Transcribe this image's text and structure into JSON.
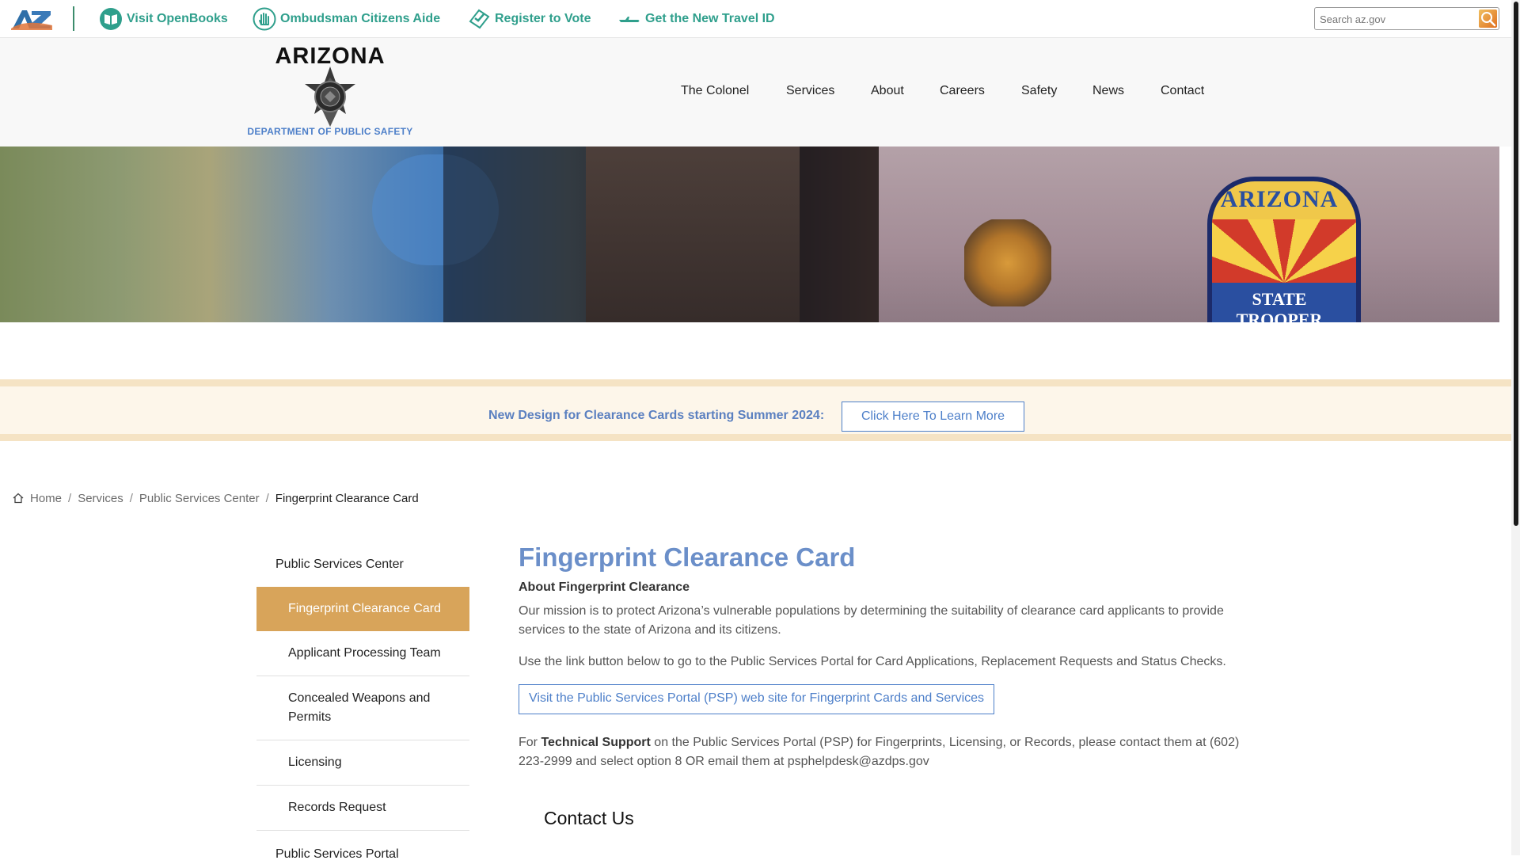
{
  "utility_bar": {
    "links": [
      {
        "label": "Visit OpenBooks",
        "icon": "book-icon"
      },
      {
        "label": "Ombudsman Citizens Aide",
        "icon": "hand-icon"
      },
      {
        "label": "Register to Vote",
        "icon": "ballot-icon"
      },
      {
        "label": "Get the New Travel ID",
        "icon": "plane-icon"
      }
    ],
    "search_placeholder": "Search az.gov"
  },
  "header": {
    "logo_wordmark": "ARIZONA",
    "agency_name": "DEPARTMENT OF PUBLIC SAFETY",
    "nav": [
      "The Colonel",
      "Services",
      "About",
      "Careers",
      "Safety",
      "News",
      "Contact"
    ]
  },
  "hero": {
    "patch_title": "ARIZONA",
    "patch_subtitle_1": "STATE",
    "patch_subtitle_2": "TROOPER"
  },
  "notice": {
    "text": "New Design for Clearance Cards starting Summer 2024:",
    "button": "Click Here To Learn More"
  },
  "breadcrumb": {
    "items": [
      "Home",
      "Services",
      "Public Services Center"
    ],
    "separator": "/",
    "current": "Fingerprint Clearance Card"
  },
  "sidebar": {
    "parent": "Public Services Center",
    "items": [
      "Fingerprint Clearance Card",
      "Applicant Processing Team",
      "Concealed Weapons and Permits",
      "Licensing",
      "Records Request"
    ],
    "active_index": 0,
    "next_parent": "Public Services Portal"
  },
  "content": {
    "title": "Fingerprint Clearance Card",
    "about_heading": "About Fingerprint Clearance",
    "mission": "Our mission is to protect Arizona’s vulnerable populations by determining the suitability of clearance card applicants to provide services to the state of Arizona and its citizens.",
    "link_instructions": "Use the link button below to go to the Public Services Portal for Card Applications, Replacement Requests and Status Checks.",
    "portal_button": "Visit the Public Services Portal (PSP) web site for Fingerprint Cards and Services",
    "support_prefix": "For",
    "support_bold": "Technical Support",
    "support_rest": "on the Public Services Portal (PSP) for Fingerprints, Licensing, or Records, please contact them at (602) 223-2999 and select option 8 OR email them at psphelpdesk@azdps.gov",
    "contact_heading": "Contact Us"
  },
  "colors": {
    "teal_link": "#2f9f8c",
    "accent_blue": "#4d7fc9",
    "title_blue": "#6b8fc9",
    "active_sidebar": "#d8a45a",
    "notice_bg": "#fdf6ea"
  }
}
